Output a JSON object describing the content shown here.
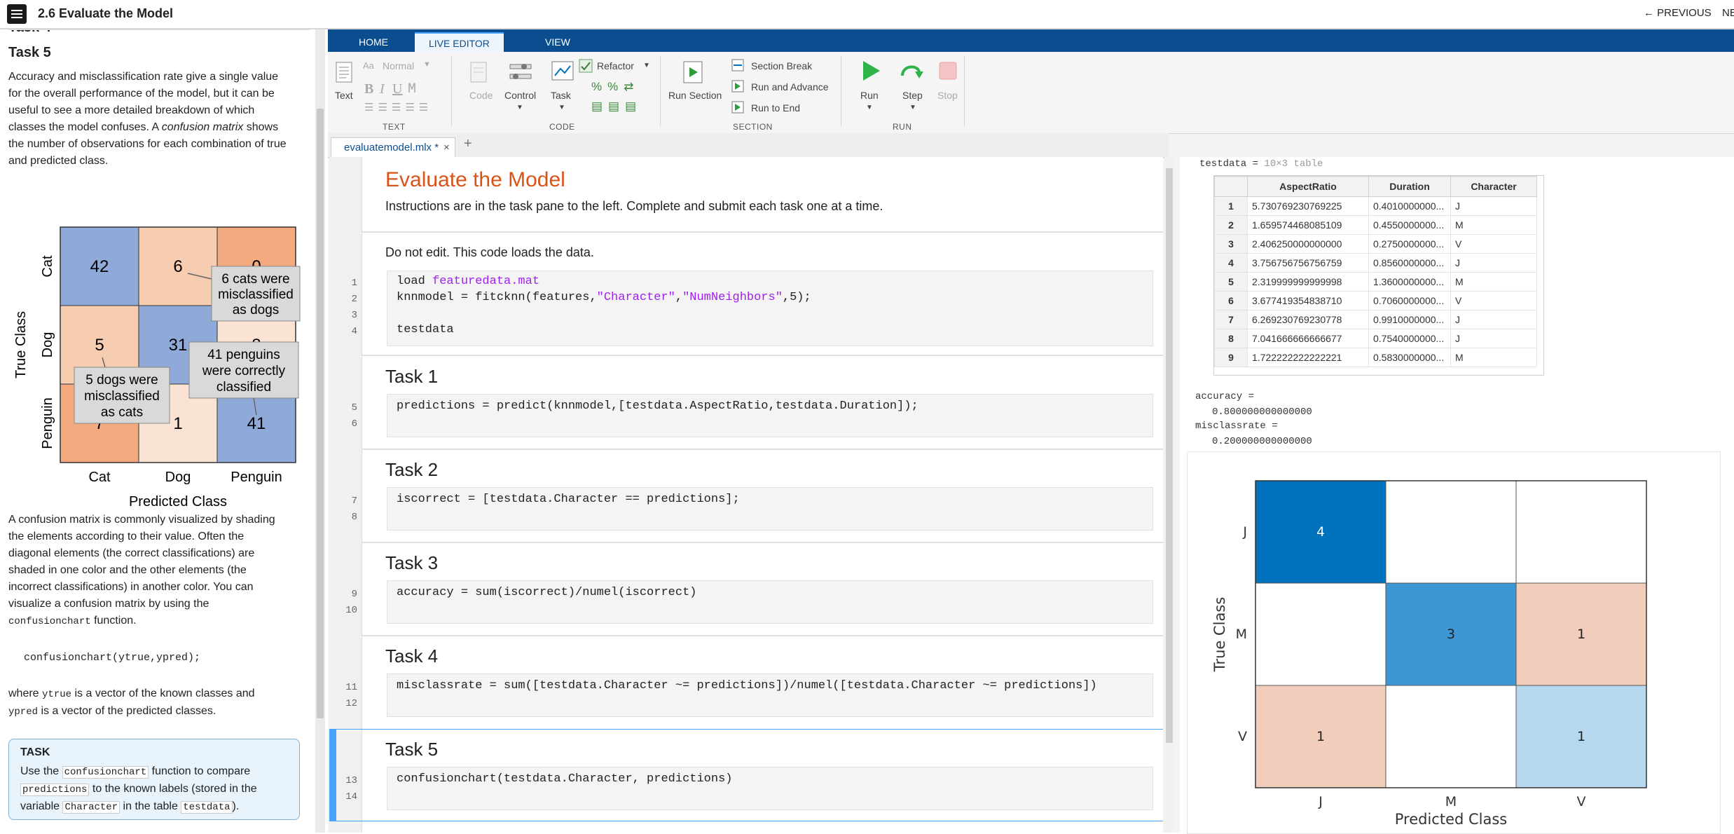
{
  "header": {
    "title": "2.6 Evaluate the Model",
    "previous_label": "← PREVIOUS",
    "next_label": "NE"
  },
  "left": {
    "cutoff_heading": "Task 4",
    "task_heading": "Task 5",
    "intro_lines": [
      "Accuracy and misclassification rate give a single value",
      "for the overall performance of the model, but it can be",
      "useful to see a more detailed breakdown of which",
      "classes the model confuses. A ",
      "confusion matrix",
      " shows",
      "the number of observations for each combination of true",
      "and predicted class."
    ],
    "figure": {
      "ylabel": "True Class",
      "xlabel": "Predicted Class",
      "rows": [
        "Cat",
        "Dog",
        "Penguin"
      ],
      "cols": [
        "Cat",
        "Dog",
        "Penguin"
      ],
      "cells": [
        [
          "42",
          "6",
          "0"
        ],
        [
          "5",
          "31",
          "3"
        ],
        [
          "7",
          "1",
          "41"
        ]
      ],
      "callout1": [
        "6 cats were",
        "misclassified",
        "as dogs"
      ],
      "callout2": [
        "41 penguins",
        "were correctly",
        "classified"
      ],
      "callout3": [
        "5 dogs were",
        "misclassified",
        "as cats"
      ]
    },
    "para2_lines": [
      "A confusion matrix is commonly visualized by shading",
      "the elements according to their value. Often the",
      "diagonal elements (the correct classifications) are",
      "shaded in one color and the other elements (the",
      "incorrect classifications) in another color. You can",
      "visualize a confusion matrix by using the"
    ],
    "para2_code": "confusionchart",
    "para2_tail": " function.",
    "code_example": "confusionchart(ytrue,ypred);",
    "para3": {
      "w1": "where ",
      "c1": "ytrue",
      "t1": " is a vector of the known classes and",
      "c2": "ypred",
      "t2": " is a vector of the predicted classes."
    },
    "task_box": {
      "title": "TASK",
      "l1a": "Use the ",
      "l1c": "confusionchart",
      "l1b": " function to compare",
      "l2c": "predictions",
      "l2b": " to the known labels (stored in the",
      "l3a": "variable ",
      "l3c": "Character",
      "l3b": " in the table ",
      "l3d": "testdata",
      "l3e": ")."
    }
  },
  "ribbon": {
    "tabs": [
      "HOME",
      "LIVE EDITOR",
      "VIEW"
    ],
    "text_group": {
      "text_label": "Text",
      "style_value": "Normal",
      "group": "TEXT"
    },
    "code_group": {
      "code_label": "Code",
      "control_label": "Control",
      "task_label": "Task",
      "refactor_label": "Refactor",
      "group": "CODE"
    },
    "section_group": {
      "run_section": "Run Section",
      "section_break": "Section Break",
      "run_advance": "Run and Advance",
      "run_end": "Run to End",
      "group": "SECTION"
    },
    "run_group": {
      "run": "Run",
      "step": "Step",
      "stop": "Stop",
      "group": "RUN"
    }
  },
  "editor": {
    "tab_label": "evaluatemodel.mlx *",
    "title": "Evaluate the Model",
    "instructions": "Instructions are in the task pane to the left. Complete and submit each task one at a time.",
    "s0_note": "Do not edit. This code loads the data.",
    "s0_l1a": "load ",
    "s0_l1b": "featuredata.mat",
    "s0_l2a": "knnmodel = fitcknn(features,",
    "s0_l2b": "\"Character\"",
    "s0_l2c": ",",
    "s0_l2d": "\"NumNeighbors\"",
    "s0_l2e": ",5);",
    "s0_l4": "testdata",
    "task1": "Task 1",
    "code1": "predictions = predict(knnmodel,[testdata.AspectRatio,testdata.Duration]);",
    "task2": "Task 2",
    "code2": "iscorrect = [testdata.Character == predictions];",
    "task3": "Task 3",
    "code3": "accuracy = sum(iscorrect)/numel(iscorrect)",
    "task4": "Task 4",
    "code4": "misclassrate = sum([testdata.Character ~= predictions])/numel([testdata.Character ~= predictions])",
    "task5": "Task 5",
    "code5": "confusionchart(testdata.Character, predictions)",
    "line_numbers": [
      "1",
      "2",
      "3",
      "4",
      "5",
      "6",
      "7",
      "8",
      "9",
      "10",
      "11",
      "12",
      "13",
      "14"
    ]
  },
  "output": {
    "table_label": "testdata = ",
    "table_size": "10×3 table",
    "columns": [
      "AspectRatio",
      "Duration",
      "Character"
    ],
    "rows": [
      [
        "1",
        "5.730769230769225",
        "0.4010000000...",
        "J"
      ],
      [
        "2",
        "1.659574468085109",
        "0.4550000000...",
        "M"
      ],
      [
        "3",
        "2.406250000000000",
        "0.2750000000...",
        "V"
      ],
      [
        "4",
        "3.756756756756759",
        "0.8560000000...",
        "J"
      ],
      [
        "5",
        "2.319999999999998",
        "1.3600000000...",
        "M"
      ],
      [
        "6",
        "3.677419354838710",
        "0.7060000000...",
        "V"
      ],
      [
        "7",
        "6.269230769230778",
        "0.9910000000...",
        "J"
      ],
      [
        "8",
        "7.041666666666677",
        "0.7540000000...",
        "J"
      ],
      [
        "9",
        "1.722222222222221",
        "0.5830000000...",
        "M"
      ]
    ],
    "accuracy_label": "accuracy =",
    "accuracy_value": "0.800000000000000",
    "misclass_label": "misclassrate =",
    "misclass_value": "0.200000000000000",
    "cm": {
      "ylabel": "True Class",
      "xlabel": "Predicted Class",
      "row_labels": [
        "J",
        "M",
        "V"
      ],
      "col_labels": [
        "J",
        "M",
        "V"
      ],
      "cells": [
        [
          "4",
          "",
          ""
        ],
        [
          "",
          "3",
          "1"
        ],
        [
          "1",
          "",
          "1"
        ]
      ],
      "colors": [
        [
          "#0072bd",
          "#ffffff",
          "#ffffff"
        ],
        [
          "#ffffff",
          "#3d97d4",
          "#f2cdbc"
        ],
        [
          "#f2cdbc",
          "#ffffff",
          "#b6d8ee"
        ]
      ]
    }
  }
}
